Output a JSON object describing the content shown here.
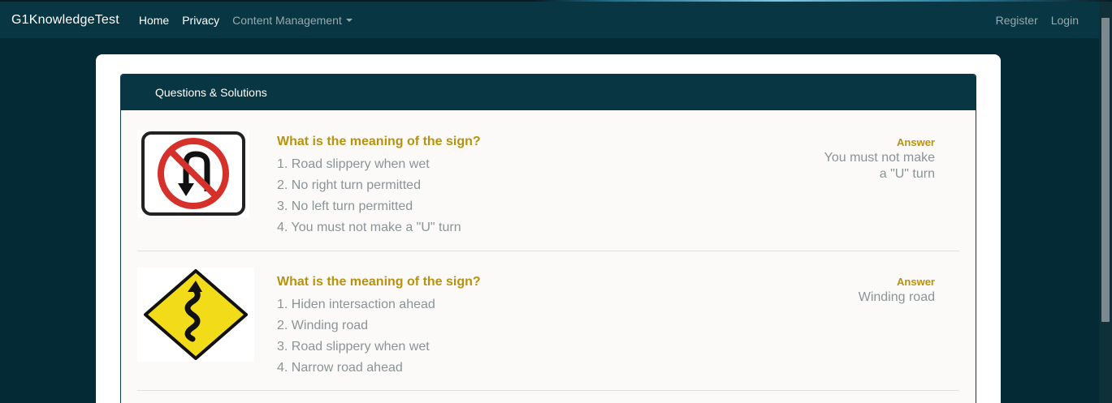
{
  "navbar": {
    "brand": "G1KnowledgeTest",
    "links": [
      "Home",
      "Privacy"
    ],
    "dropdown": "Content Management",
    "right_links": [
      "Register",
      "Login"
    ]
  },
  "card": {
    "header": "Questions & Solutions"
  },
  "questions": [
    {
      "question": "What is the meaning of the sign?",
      "options": [
        "1. Road slippery when wet",
        "2. No right turn permitted",
        "3. No left turn permitted",
        "4. You must not make a \"U\" turn"
      ],
      "answer_label": "Answer",
      "answer_line1": "You must not make",
      "answer_line2": "a \"U\" turn",
      "sign_icon": "no-u-turn-sign-icon"
    },
    {
      "question": "What is the meaning of the sign?",
      "options": [
        "1. Hiden intersaction ahead",
        "2. Winding road",
        "3. Road slippery when wet",
        "4. Narrow road ahead"
      ],
      "answer_label": "Answer",
      "answer_line1": "Winding road",
      "sign_icon": "winding-road-sign-icon"
    }
  ],
  "colors": {
    "page_bg": "#032a35",
    "navbar_bg": "#083642",
    "accent": "#b8920c",
    "muted_text": "#8a9497"
  }
}
